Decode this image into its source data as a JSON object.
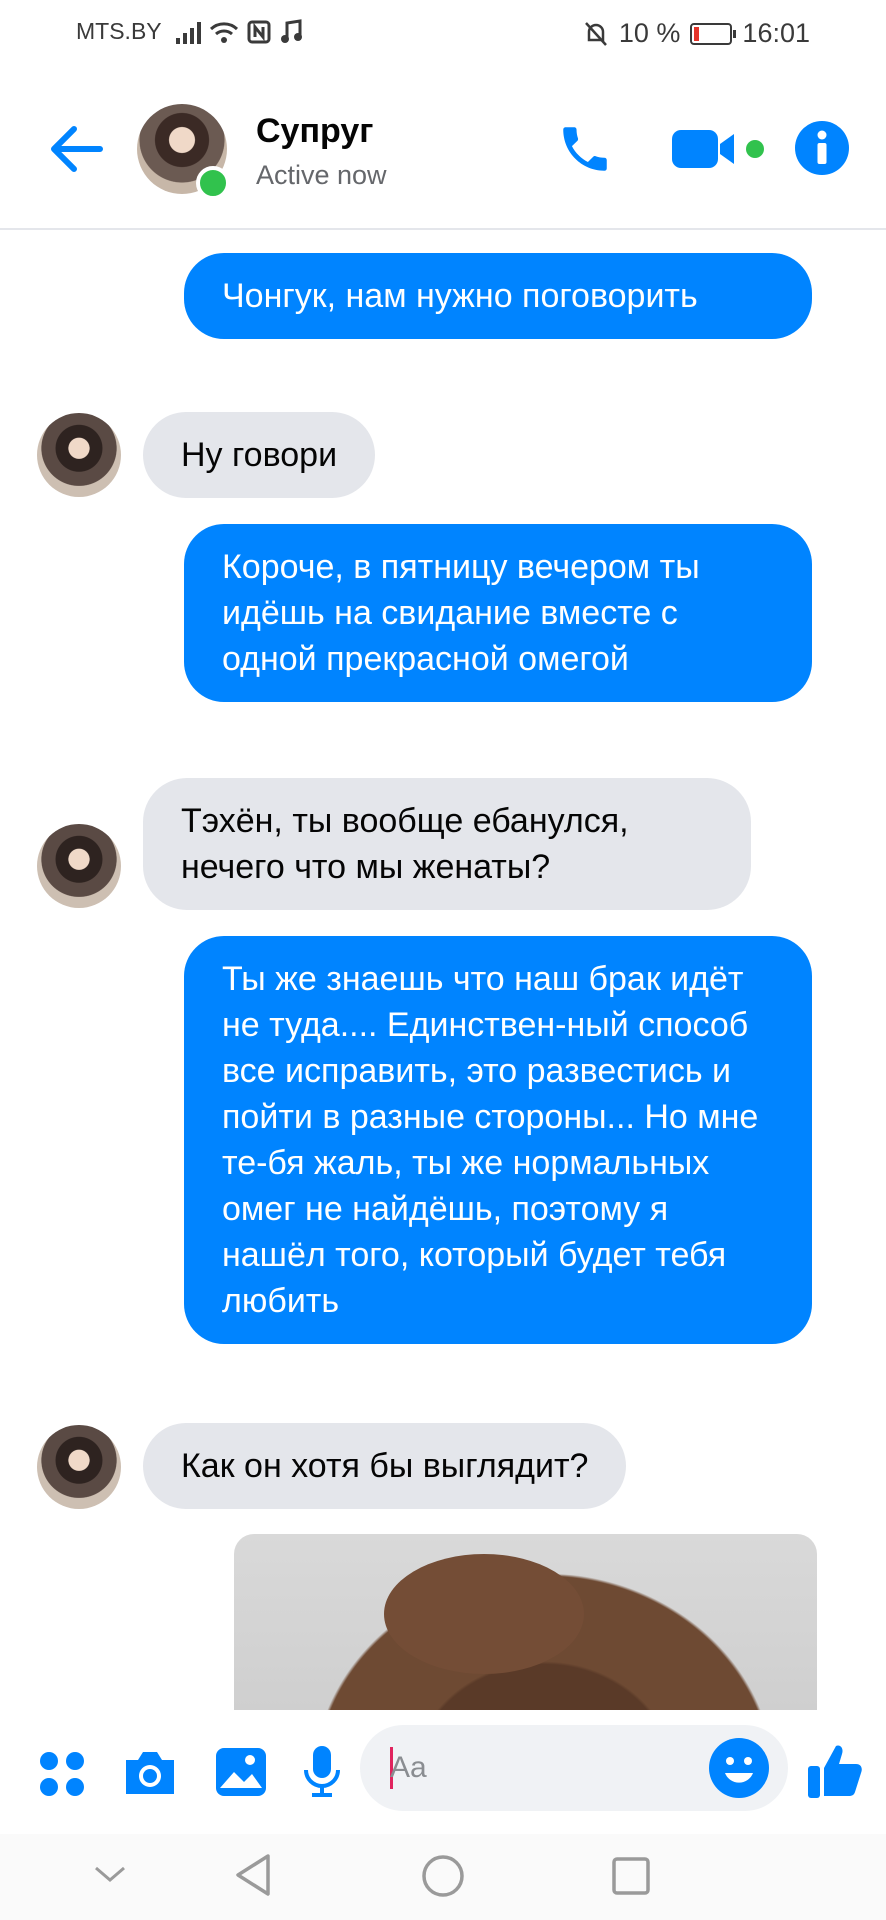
{
  "status_bar": {
    "carrier": "MTS.BY",
    "battery": "10 %",
    "time": "16:01"
  },
  "header": {
    "contact_name": "Супруг",
    "status": "Active now"
  },
  "messages": [
    {
      "direction": "out",
      "text": "Чонгук, нам нужно поговорить"
    },
    {
      "direction": "in",
      "text": "Ну говори"
    },
    {
      "direction": "out",
      "text": "Короче, в пятницу вечером ты идёшь на свидание вместе с одной прекрасной омегой"
    },
    {
      "direction": "in",
      "text": "Тэхён, ты вообще ебанулся, нечего что мы женаты?"
    },
    {
      "direction": "out",
      "text": "Ты же знаешь что наш брак идёт не туда.... Единствен-ный способ все исправить, это развестись и пойти в разные стороны... Но мне те-бя жаль, ты же нормальных омег не найдёшь, поэтому я нашёл того, который будет тебя любить"
    },
    {
      "direction": "in",
      "text": "Как он хотя бы выглядит?"
    }
  ],
  "composer": {
    "placeholder": "Aa"
  },
  "colors": {
    "accent": "#0084ff",
    "incoming_bubble": "#e4e6eb",
    "online": "#31c24d"
  },
  "icons": [
    "back-arrow-icon",
    "phone-icon",
    "video-camera-icon",
    "info-icon",
    "apps-icon",
    "camera-icon",
    "gallery-icon",
    "microphone-icon",
    "emoji-icon",
    "like-icon",
    "nav-back-icon",
    "nav-home-icon",
    "nav-recents-icon",
    "nav-collapse-icon"
  ]
}
